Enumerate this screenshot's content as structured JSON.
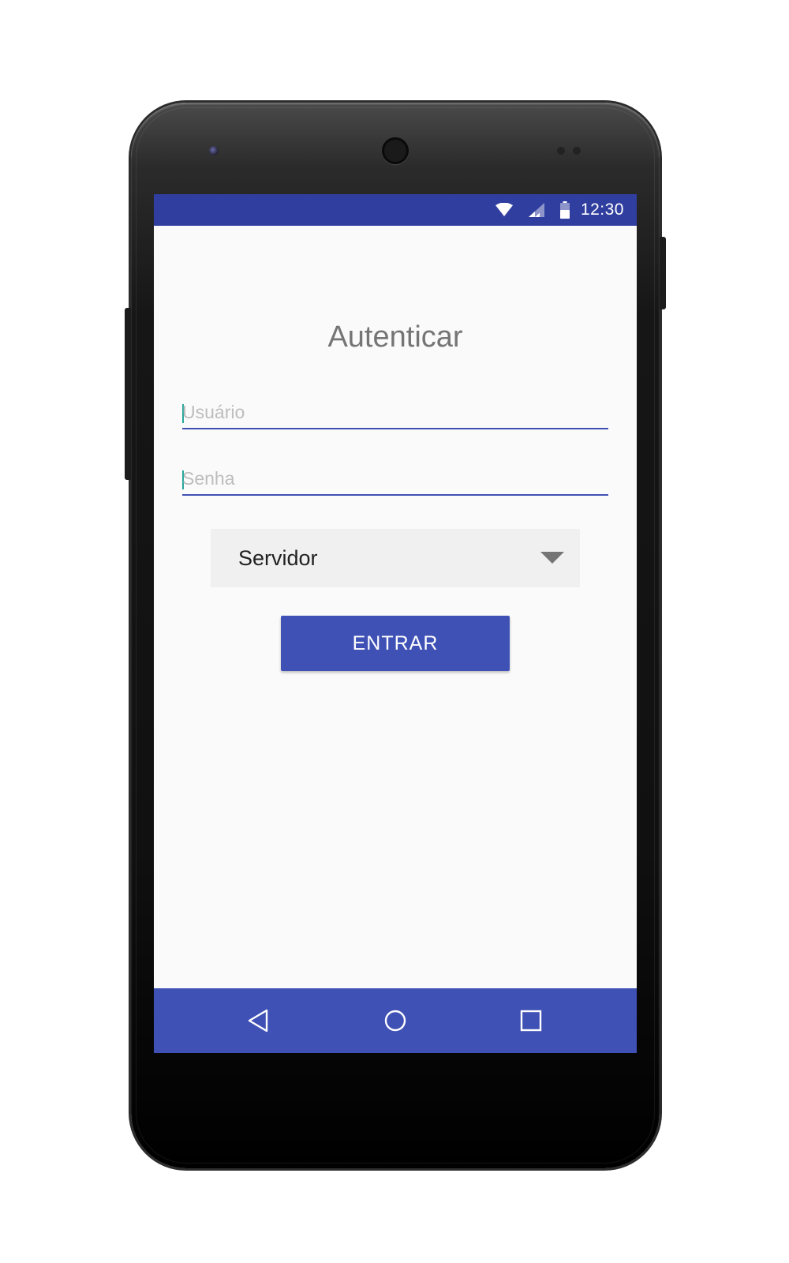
{
  "status_bar": {
    "time": "12:30",
    "icons": [
      "wifi-icon",
      "cell-signal-icon",
      "battery-icon"
    ],
    "color": "#303f9f"
  },
  "screen": {
    "title": "Autenticar",
    "username": {
      "placeholder": "Usuário",
      "value": ""
    },
    "password": {
      "placeholder": "Senha",
      "value": ""
    },
    "server_select": {
      "selected": "Servidor"
    },
    "enter_button": {
      "label": "ENTRAR"
    }
  },
  "nav_bar": {
    "buttons": [
      "back-icon",
      "home-icon",
      "recents-icon"
    ],
    "color": "#3f51b5"
  },
  "colors": {
    "primary": "#3f51b5",
    "primary_dark": "#303f9f",
    "accent": "#26a69a",
    "background": "#fafafa"
  }
}
